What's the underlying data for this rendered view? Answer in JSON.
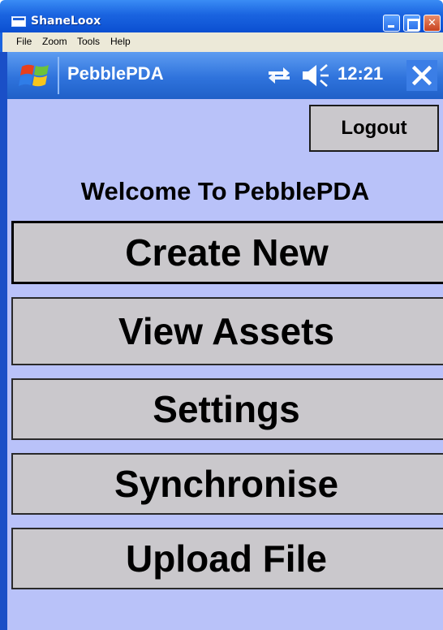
{
  "window": {
    "title": "ShaneLoox",
    "menu": [
      "File",
      "Zoom",
      "Tools",
      "Help"
    ]
  },
  "taskbar": {
    "app_title": "PebblePDA",
    "clock": "12:21",
    "icons": [
      "windows-start-icon",
      "sync-icon",
      "volume-muted-icon",
      "close-icon"
    ]
  },
  "logout_label": "Logout",
  "welcome_text": "Welcome To PebblePDA",
  "menu_buttons": [
    {
      "label": "Create New"
    },
    {
      "label": "View Assets"
    },
    {
      "label": "Settings"
    },
    {
      "label": "Synchronise"
    },
    {
      "label": "Upload File"
    }
  ],
  "colors": {
    "screen_background": "#b9c2f9",
    "button_face": "#cac8cc",
    "taskbar_blue": "#2f73dc"
  }
}
